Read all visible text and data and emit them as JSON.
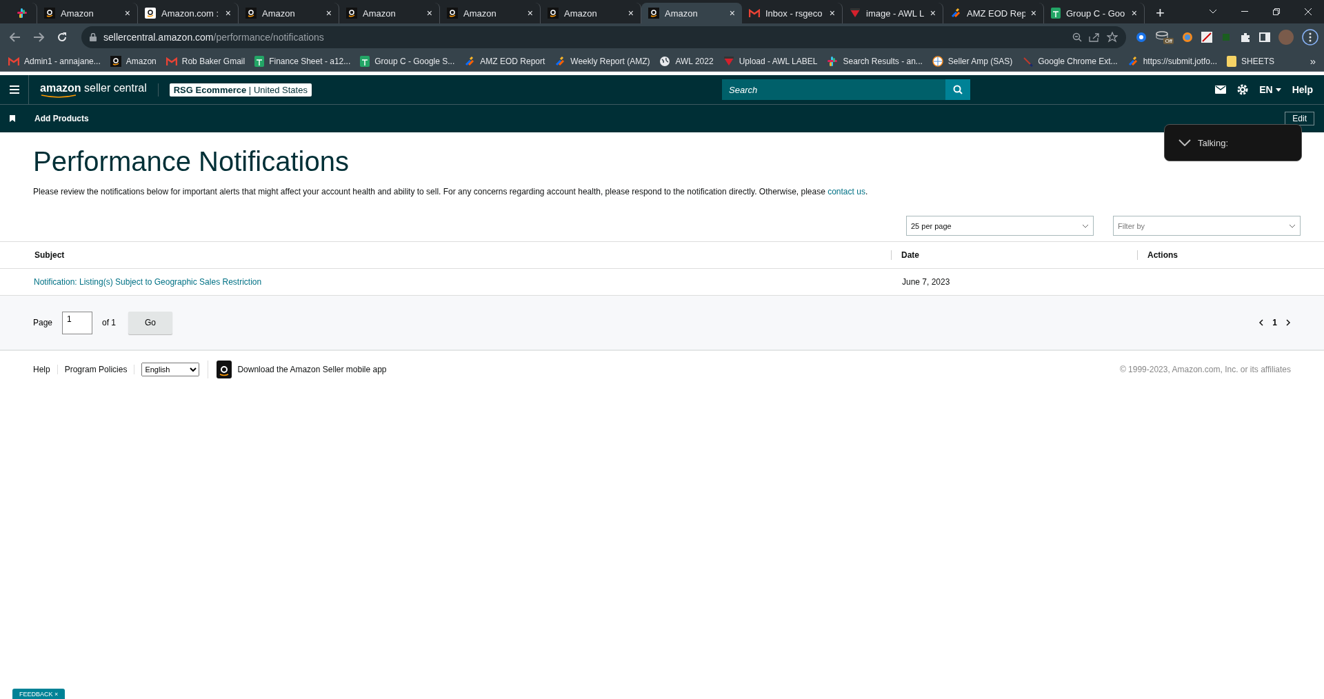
{
  "browser": {
    "tabs": [
      {
        "kind": "slack",
        "selected": false
      },
      {
        "kind": "amazon",
        "title": "Amazon",
        "close": "×",
        "selected": false
      },
      {
        "kind": "amazon-white",
        "title": "Amazon.com :",
        "close": "×",
        "selected": false
      },
      {
        "kind": "amazon",
        "title": "Amazon",
        "close": "×",
        "selected": false
      },
      {
        "kind": "amazon",
        "title": "Amazon",
        "close": "×",
        "selected": false
      },
      {
        "kind": "amazon",
        "title": "Amazon",
        "close": "×",
        "selected": false
      },
      {
        "kind": "amazon",
        "title": "Amazon",
        "close": "×",
        "selected": false
      },
      {
        "kind": "amazon",
        "title": "Amazon",
        "close": "×",
        "selected": true
      },
      {
        "kind": "gmail",
        "title": "Inbox - rsgeco",
        "close": "×",
        "selected": false
      },
      {
        "kind": "awl",
        "title": "image - AWL L",
        "close": "×",
        "selected": false
      },
      {
        "kind": "jotform",
        "title": "AMZ EOD Rep",
        "close": "×",
        "selected": false
      },
      {
        "kind": "sheets",
        "title": "Group C - Goo",
        "close": "×",
        "selected": false
      }
    ],
    "new_tab": "+",
    "url_host": "sellercentral.amazon.com",
    "url_path": "/performance/notifications",
    "extension_badge": "Off",
    "bookmarks": [
      {
        "kind": "gmail",
        "label": "Admin1 - annajane..."
      },
      {
        "kind": "amazon",
        "label": "Amazon"
      },
      {
        "kind": "gmail",
        "label": "Rob Baker Gmail"
      },
      {
        "kind": "sheets",
        "label": "Finance Sheet - a12..."
      },
      {
        "kind": "sheets",
        "label": "Group C - Google S..."
      },
      {
        "kind": "jotform",
        "label": "AMZ EOD Report"
      },
      {
        "kind": "jotform",
        "label": "Weekly Report (AMZ)"
      },
      {
        "kind": "globe",
        "label": "AWL 2022"
      },
      {
        "kind": "awl",
        "label": "Upload - AWL LABEL"
      },
      {
        "kind": "slack",
        "label": "Search Results - an..."
      },
      {
        "kind": "sas",
        "label": "Seller Amp (SAS)"
      },
      {
        "kind": "pen",
        "label": "Google Chrome Ext..."
      },
      {
        "kind": "jotform",
        "label": "https://submit.jotfo..."
      },
      {
        "kind": "folder",
        "label": "SHEETS"
      }
    ],
    "more": "»"
  },
  "header": {
    "logo_bold": "amazon",
    "logo_light": "seller central",
    "store_name": "RSG Ecommerce",
    "store_separator": "|",
    "store_region": "United States",
    "search_placeholder": "Search",
    "language": "EN",
    "help": "Help"
  },
  "subnav": {
    "items": [
      "Add Products"
    ],
    "edit": "Edit"
  },
  "popup": {
    "text": "Talking:"
  },
  "page": {
    "title": "Performance Notifications",
    "description": "Please review the notifications below for important alerts that might affect your account health and ability to sell. For any concerns regarding account health, please respond to the notification directly. Otherwise, please ",
    "description_link": "contact us",
    "description_end": ".",
    "per_page": "25 per page",
    "filter_placeholder": "Filter by",
    "table": {
      "columns": [
        "Subject",
        "Date",
        "Actions"
      ],
      "rows": [
        {
          "subject": "Notification: Listing(s) Subject to Geographic Sales Restriction",
          "date": "June 7, 2023"
        }
      ]
    },
    "pagination": {
      "label": "Page",
      "value": "1",
      "of": "of 1",
      "go": "Go",
      "current": "1"
    }
  },
  "footer": {
    "links": [
      "Help",
      "Program Policies"
    ],
    "language": "English",
    "app_text": "Download the Amazon Seller mobile app",
    "copyright": "© 1999-2023, Amazon.com, Inc. or its affiliates"
  },
  "feedback": "FEEDBACK ×"
}
